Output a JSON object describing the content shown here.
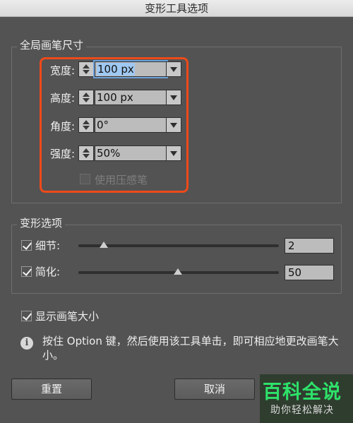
{
  "window": {
    "title": "变形工具选项"
  },
  "brush_size": {
    "title": "全局画笔尺寸",
    "fields": [
      {
        "label": "宽度:",
        "value": "100 px",
        "selected": true
      },
      {
        "label": "高度:",
        "value": "100 px"
      },
      {
        "label": "角度:",
        "value": "0°"
      },
      {
        "label": "强度:",
        "value": "50%"
      }
    ],
    "pressure_checkbox": {
      "label": "使用压感笔",
      "checked": false,
      "enabled": false
    }
  },
  "warp_options": {
    "title": "变形选项",
    "detail": {
      "label": "细节:",
      "checked": true,
      "value": "2"
    },
    "simplify": {
      "label": "简化:",
      "checked": true,
      "value": "50"
    }
  },
  "show_brush_size": {
    "label": "显示画笔大小",
    "checked": true
  },
  "info": {
    "icon": "info-icon",
    "text": "按住 Option 键，然后使用该工具单击，即可相应地更改画笔大小。"
  },
  "buttons": {
    "reset": "重置",
    "cancel": "取消"
  },
  "watermark": {
    "main": "百科全说",
    "sub": "助你轻松解决"
  },
  "colors": {
    "highlight": "#ee4a1a",
    "selection": "#9fc8f2",
    "background": "#535353"
  }
}
